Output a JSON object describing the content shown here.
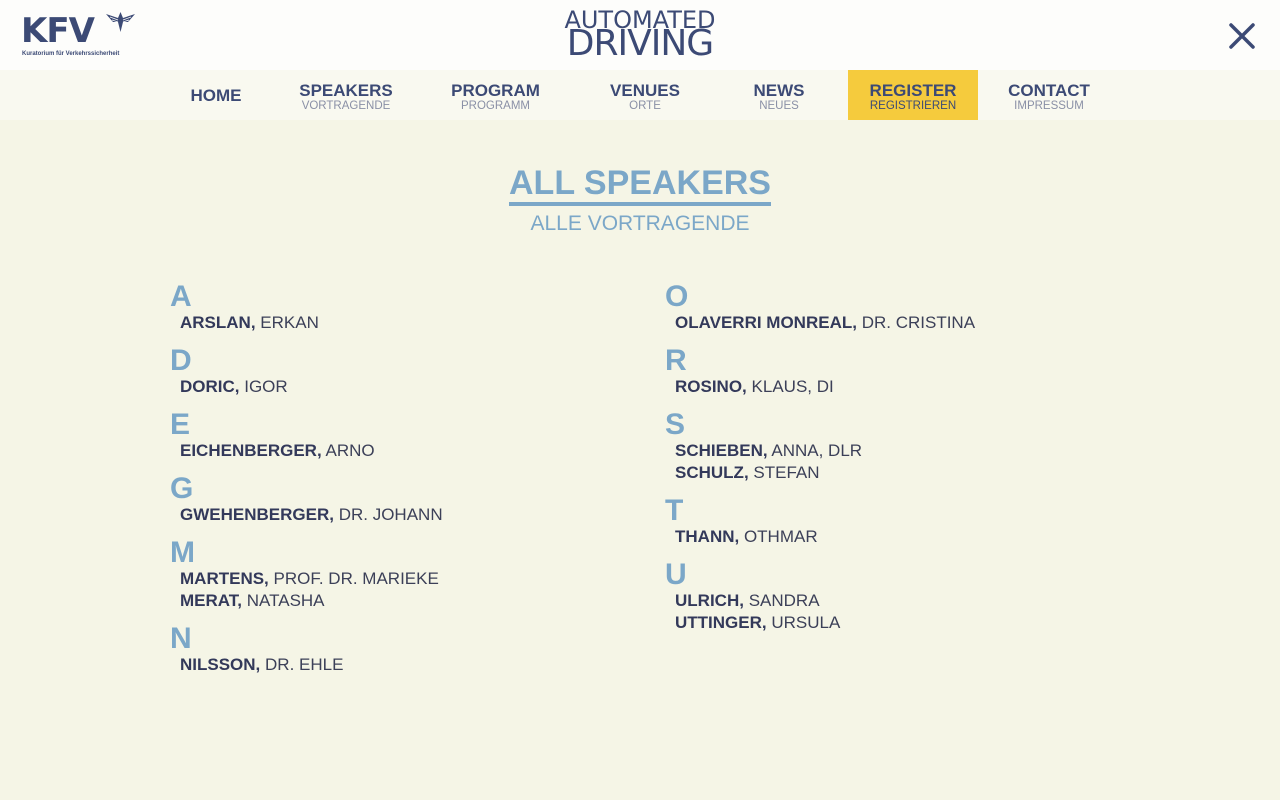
{
  "header": {
    "logo_text": "KFV",
    "logo_tagline": "Kuratorium für Verkehrssicherheit",
    "brand_line1": "AUTOMATED",
    "brand_line2": "DRIVING",
    "close_icon": "close-icon",
    "brand_color": "#3c4a75"
  },
  "nav": {
    "items": [
      {
        "label": "HOME",
        "sub": ""
      },
      {
        "label": "SPEAKERS",
        "sub": "VORTRAGENDE"
      },
      {
        "label": "PROGRAM",
        "sub": "PROGRAMM"
      },
      {
        "label": "VENUES",
        "sub": "ORTE"
      },
      {
        "label": "NEWS",
        "sub": "NEUES"
      },
      {
        "label": "REGISTER",
        "sub": "REGISTRIEREN"
      },
      {
        "label": "CONTACT",
        "sub": "IMPRESSUM"
      }
    ],
    "active_color": "#f5cb3d"
  },
  "page": {
    "title": "ALL SPEAKERS",
    "subtitle": "ALLE VORTRAGENDE",
    "accent_color": "#7ba7c8"
  },
  "speakers": {
    "left": [
      {
        "letter": "A",
        "people": [
          {
            "last": "ARSLAN,",
            "first": "ERKAN"
          }
        ]
      },
      {
        "letter": "D",
        "people": [
          {
            "last": "DORIC,",
            "first": "IGOR"
          }
        ]
      },
      {
        "letter": "E",
        "people": [
          {
            "last": "EICHENBERGER,",
            "first": "ARNO"
          }
        ]
      },
      {
        "letter": "G",
        "people": [
          {
            "last": "GWEHENBERGER,",
            "first": "DR. JOHANN"
          }
        ]
      },
      {
        "letter": "M",
        "people": [
          {
            "last": "MARTENS,",
            "first": "PROF. DR. MARIEKE"
          },
          {
            "last": "MERAT,",
            "first": "NATASHA"
          }
        ]
      },
      {
        "letter": "N",
        "people": [
          {
            "last": "NILSSON,",
            "first": "DR. EHLE"
          }
        ]
      }
    ],
    "right": [
      {
        "letter": "O",
        "people": [
          {
            "last": "OLAVERRI MONREAL,",
            "first": "DR. CRISTINA"
          }
        ]
      },
      {
        "letter": "R",
        "people": [
          {
            "last": "ROSINO,",
            "first": "KLAUS, DI"
          }
        ]
      },
      {
        "letter": "S",
        "people": [
          {
            "last": "SCHIEBEN,",
            "first": "ANNA, DLR"
          },
          {
            "last": "SCHULZ,",
            "first": "STEFAN"
          }
        ]
      },
      {
        "letter": "T",
        "people": [
          {
            "last": "THANN,",
            "first": "OTHMAR"
          }
        ]
      },
      {
        "letter": "U",
        "people": [
          {
            "last": "ULRICH,",
            "first": "SANDRA"
          },
          {
            "last": "UTTINGER,",
            "first": "URSULA"
          }
        ]
      }
    ]
  }
}
